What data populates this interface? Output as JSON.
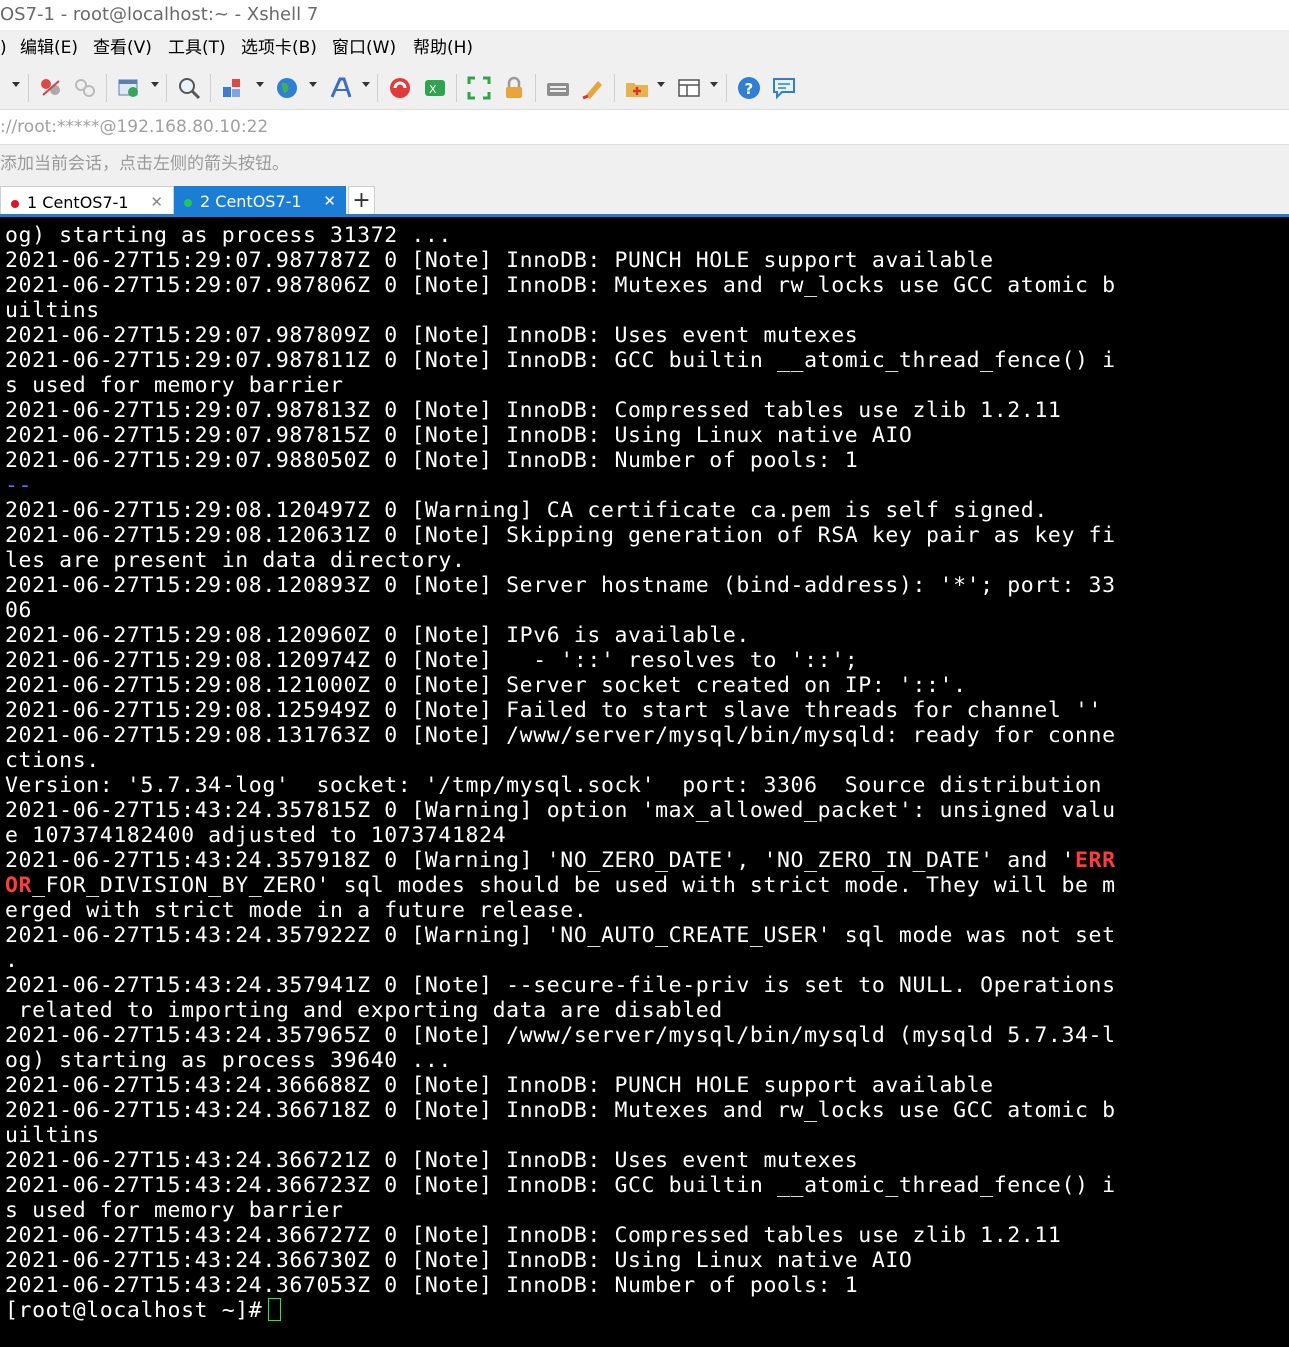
{
  "window": {
    "title": "OS7-1 - root@localhost:~ - Xshell 7"
  },
  "menu": [
    {
      "label": ")"
    },
    {
      "label": "编辑(E)"
    },
    {
      "label": "查看(V)"
    },
    {
      "label": "工具(T)"
    },
    {
      "label": "选项卡(B)"
    },
    {
      "label": "窗口(W)"
    },
    {
      "label": "帮助(H)"
    }
  ],
  "toolbar_icons": [
    "new-session-dropdown-icon",
    "disconnect-icon",
    "reconnect-icon",
    "session-properties-icon",
    "find-icon",
    "transfer-icon",
    "globe-icon",
    "font-icon",
    "xftp-icon",
    "xmanager-icon",
    "fullscreen-icon",
    "lock-icon",
    "keyboard-icon",
    "highlight-icon",
    "compose-icon",
    "layout-icon",
    "help-icon",
    "chat-icon"
  ],
  "address": {
    "value": "://root:*****@192.168.80.10:22"
  },
  "hint": {
    "text": "添加当前会话，点击左侧的箭头按钮。"
  },
  "tabs": [
    {
      "label": "1 CentOS7-1",
      "status_color": "#e81123",
      "active": false
    },
    {
      "label": "2 CentOS7-1",
      "status_color": "#22c55e",
      "active": true
    }
  ],
  "colors": {
    "accent": "#1c7dd6",
    "terminal_bg": "#000000",
    "terminal_fg": "#ffffff",
    "error_highlight": "#ff3b3b",
    "separator_highlight": "#3b7cff",
    "cursor": "#2ee62e"
  },
  "terminal": {
    "lines": [
      "og) starting as process 31372 ...",
      "2021-06-27T15:29:07.987787Z 0 [Note] InnoDB: PUNCH HOLE support available",
      "2021-06-27T15:29:07.987806Z 0 [Note] InnoDB: Mutexes and rw_locks use GCC atomic b",
      "uiltins",
      "2021-06-27T15:29:07.987809Z 0 [Note] InnoDB: Uses event mutexes",
      "2021-06-27T15:29:07.987811Z 0 [Note] InnoDB: GCC builtin __atomic_thread_fence() i",
      "s used for memory barrier",
      "2021-06-27T15:29:07.987813Z 0 [Note] InnoDB: Compressed tables use zlib 1.2.11",
      "2021-06-27T15:29:07.987815Z 0 [Note] InnoDB: Using Linux native AIO",
      "2021-06-27T15:29:07.988050Z 0 [Note] InnoDB: Number of pools: 1",
      "--",
      "2021-06-27T15:29:08.120497Z 0 [Warning] CA certificate ca.pem is self signed.",
      "2021-06-27T15:29:08.120631Z 0 [Note] Skipping generation of RSA key pair as key fi",
      "les are present in data directory.",
      "2021-06-27T15:29:08.120893Z 0 [Note] Server hostname (bind-address): '*'; port: 33",
      "06",
      "2021-06-27T15:29:08.120960Z 0 [Note] IPv6 is available.",
      "2021-06-27T15:29:08.120974Z 0 [Note]   - '::' resolves to '::';",
      "2021-06-27T15:29:08.121000Z 0 [Note] Server socket created on IP: '::'.",
      "2021-06-27T15:29:08.125949Z 0 [Note] Failed to start slave threads for channel ''",
      "2021-06-27T15:29:08.131763Z 0 [Note] /www/server/mysql/bin/mysqld: ready for conne",
      "ctions.",
      "Version: '5.7.34-log'  socket: '/tmp/mysql.sock'  port: 3306  Source distribution",
      "2021-06-27T15:43:24.357815Z 0 [Warning] option 'max_allowed_packet': unsigned valu",
      "e 107374182400 adjusted to 1073741824",
      "2021-06-27T15:43:24.357918Z 0 [Warning] 'NO_ZERO_DATE', 'NO_ZERO_IN_DATE' and 'ERR",
      "OR_FOR_DIVISION_BY_ZERO' sql modes should be used with strict mode. They will be m",
      "erged with strict mode in a future release.",
      "2021-06-27T15:43:24.357922Z 0 [Warning] 'NO_AUTO_CREATE_USER' sql mode was not set",
      ".",
      "2021-06-27T15:43:24.357941Z 0 [Note] --secure-file-priv is set to NULL. Operations",
      " related to importing and exporting data are disabled",
      "2021-06-27T15:43:24.357965Z 0 [Note] /www/server/mysql/bin/mysqld (mysqld 5.7.34-l",
      "og) starting as process 39640 ...",
      "2021-06-27T15:43:24.366688Z 0 [Note] InnoDB: PUNCH HOLE support available",
      "2021-06-27T15:43:24.366718Z 0 [Note] InnoDB: Mutexes and rw_locks use GCC atomic b",
      "uiltins",
      "2021-06-27T15:43:24.366721Z 0 [Note] InnoDB: Uses event mutexes",
      "2021-06-27T15:43:24.366723Z 0 [Note] InnoDB: GCC builtin __atomic_thread_fence() i",
      "s used for memory barrier",
      "2021-06-27T15:43:24.366727Z 0 [Note] InnoDB: Compressed tables use zlib 1.2.11",
      "2021-06-27T15:43:24.366730Z 0 [Note] InnoDB: Using Linux native AIO",
      "2021-06-27T15:43:24.367053Z 0 [Note] InnoDB: Number of pools: 1"
    ],
    "prompt": "[root@localhost ~]#"
  }
}
